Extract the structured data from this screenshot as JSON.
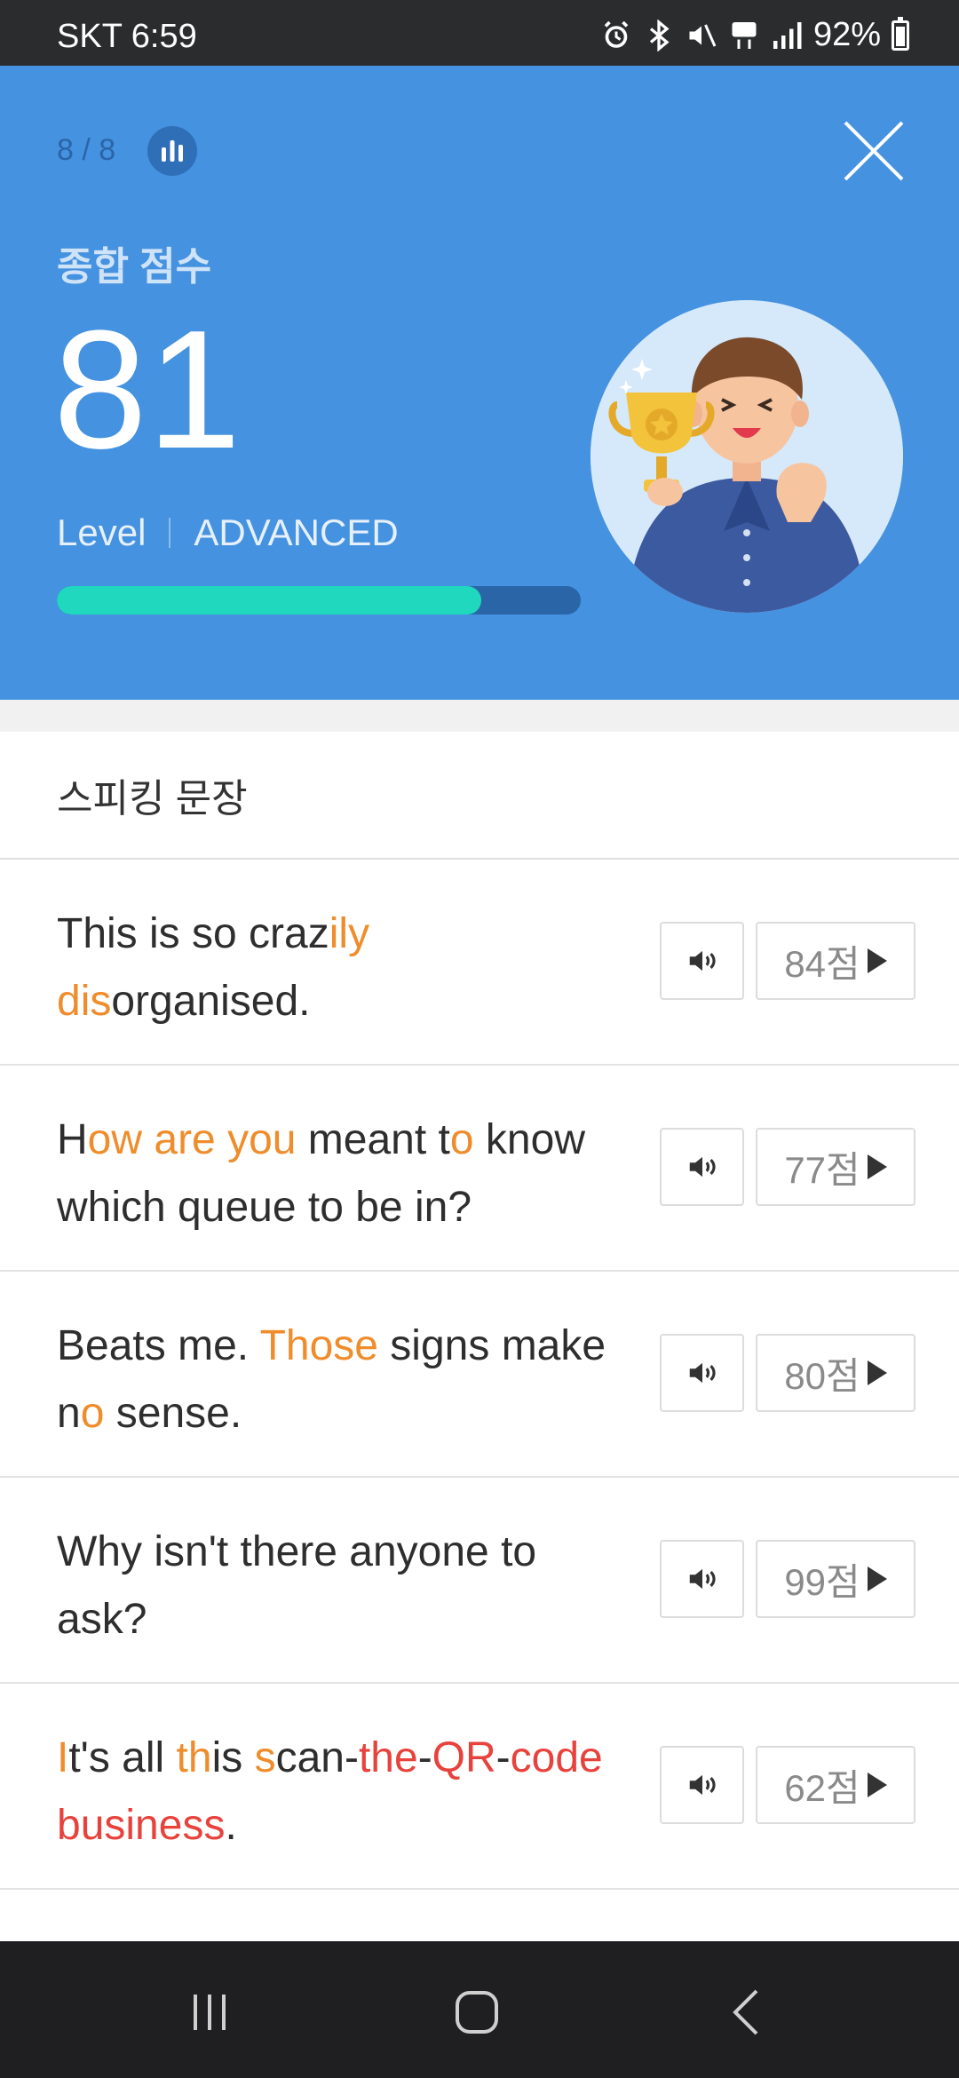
{
  "status_bar": {
    "carrier_time": "SKT 6:59",
    "battery_level": "92%",
    "icons": [
      "alarm-icon",
      "bluetooth-icon",
      "mute-icon",
      "5g-icon",
      "signal-icon",
      "battery-icon"
    ]
  },
  "header": {
    "progress": "8 / 8",
    "score_title": "종합 점수",
    "score_value": "81",
    "level_label": "Level",
    "level_value": "ADVANCED",
    "level_progress_fraction": 0.81,
    "colors": {
      "background": "#4592e0",
      "progress_fill": "#1fd8be",
      "progress_track": "#2a65a8"
    }
  },
  "list": {
    "section_title": "스피킹 문장",
    "rows": [
      {
        "score": "84점",
        "segments": [
          {
            "t": "This is so craz",
            "c": "n"
          },
          {
            "t": "ily",
            "c": "o"
          },
          {
            "t": " ",
            "c": "n"
          },
          {
            "t": "dis",
            "c": "o"
          },
          {
            "t": "organised.",
            "c": "n"
          }
        ]
      },
      {
        "score": "77점",
        "segments": [
          {
            "t": "H",
            "c": "n"
          },
          {
            "t": "ow are you",
            "c": "o"
          },
          {
            "t": " meant t",
            "c": "n"
          },
          {
            "t": "o",
            "c": "o"
          },
          {
            "t": " know which queue to be in?",
            "c": "n"
          }
        ]
      },
      {
        "score": "80점",
        "segments": [
          {
            "t": "Beats me. ",
            "c": "n"
          },
          {
            "t": "Those",
            "c": "o"
          },
          {
            "t": " signs make n",
            "c": "n"
          },
          {
            "t": "o",
            "c": "o"
          },
          {
            "t": " sense.",
            "c": "n"
          }
        ]
      },
      {
        "score": "99점",
        "segments": [
          {
            "t": "Why isn't there anyone to ask?",
            "c": "n"
          }
        ]
      },
      {
        "score": "62점",
        "segments": [
          {
            "t": "I",
            "c": "o"
          },
          {
            "t": "t's all ",
            "c": "n"
          },
          {
            "t": "th",
            "c": "o"
          },
          {
            "t": "is ",
            "c": "n"
          },
          {
            "t": "s",
            "c": "o"
          },
          {
            "t": "can-",
            "c": "n"
          },
          {
            "t": "the",
            "c": "r"
          },
          {
            "t": "-",
            "c": "n"
          },
          {
            "t": "QR",
            "c": "r"
          },
          {
            "t": "-",
            "c": "n"
          },
          {
            "t": "code business",
            "c": "r"
          },
          {
            "t": ".",
            "c": "n"
          }
        ]
      }
    ]
  },
  "nav": {
    "icons": [
      "recent-apps-icon",
      "home-icon",
      "back-icon"
    ]
  }
}
